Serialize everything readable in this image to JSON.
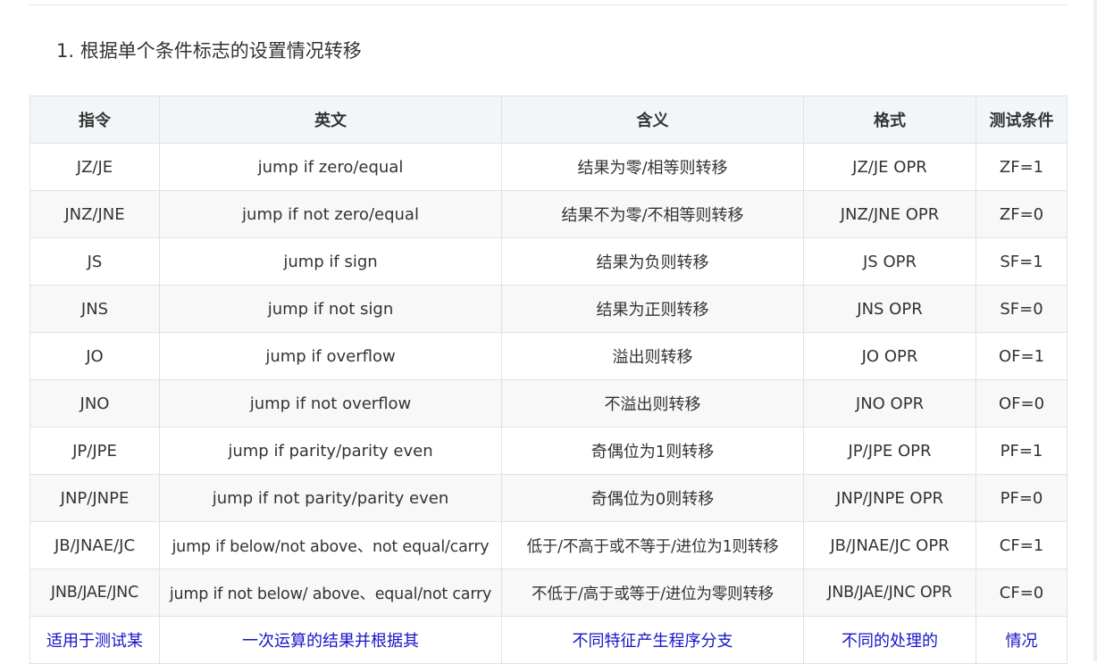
{
  "heading": "1. 根据单个条件标志的设置情况转移",
  "table": {
    "headers": [
      "指令",
      "英文",
      "含义",
      "格式",
      "测试条件"
    ],
    "rows": [
      [
        "JZ/JE",
        "jump if zero/equal",
        "结果为零/相等则转移",
        "JZ/JE OPR",
        "ZF=1"
      ],
      [
        "JNZ/JNE",
        "jump if not zero/equal",
        "结果不为零/不相等则转移",
        "JNZ/JNE OPR",
        "ZF=0"
      ],
      [
        "JS",
        "jump if sign",
        "结果为负则转移",
        "JS OPR",
        "SF=1"
      ],
      [
        "JNS",
        "jump if not sign",
        "结果为正则转移",
        "JNS OPR",
        "SF=0"
      ],
      [
        "JO",
        "jump if overflow",
        "溢出则转移",
        "JO OPR",
        "OF=1"
      ],
      [
        "JNO",
        "jump if not overflow",
        "不溢出则转移",
        "JNO OPR",
        "OF=0"
      ],
      [
        "JP/JPE",
        "jump if parity/parity even",
        "奇偶位为1则转移",
        "JP/JPE OPR",
        "PF=1"
      ],
      [
        "JNP/JNPE",
        "jump if not parity/parity even",
        "奇偶位为0则转移",
        "JNP/JNPE OPR",
        "PF=0"
      ],
      [
        "JB/JNAE/JC",
        "jump if below/not above、not equal/carry",
        "低于/不高于或不等于/进位为1则转移",
        "JB/JNAE/JC OPR",
        "CF=1"
      ],
      [
        "JNB/JAE/JNC",
        "jump if not below/ above、equal/not carry",
        "不低于/高于或等于/进位为零则转移",
        "JNB/JAE/JNC OPR",
        "CF=0"
      ]
    ],
    "link_row": [
      "适用于测试某",
      "一次运算的结果并根据其",
      "不同特征产生程序分支",
      "不同的处理的",
      "情况"
    ]
  }
}
